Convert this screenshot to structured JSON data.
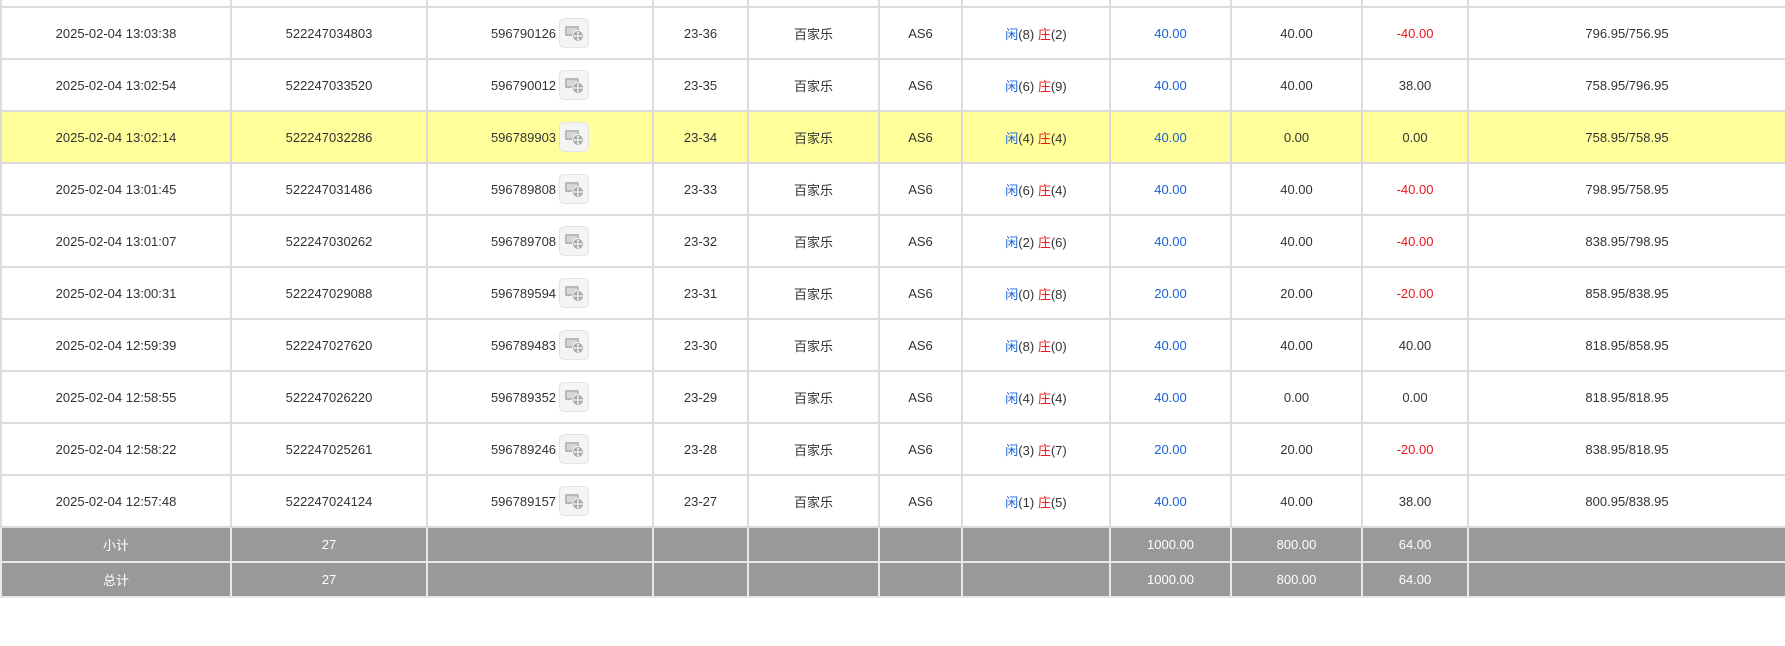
{
  "rows": [
    {
      "time": "2025-02-04 13:03:38",
      "order_id": "522247034803",
      "game_no": "596790126",
      "shoe": "23-36",
      "game_type": "百家乐",
      "table": "AS6",
      "player_label": "闲",
      "player_score": "(8)",
      "banker_label": "庄",
      "banker_score": "(2)",
      "bet": "40.00",
      "valid": "40.00",
      "winloss": "-40.00",
      "winloss_color": "red",
      "balance": "796.95/756.95",
      "highlight": false
    },
    {
      "time": "2025-02-04 13:02:54",
      "order_id": "522247033520",
      "game_no": "596790012",
      "shoe": "23-35",
      "game_type": "百家乐",
      "table": "AS6",
      "player_label": "闲",
      "player_score": "(6)",
      "banker_label": "庄",
      "banker_score": "(9)",
      "bet": "40.00",
      "valid": "40.00",
      "winloss": "38.00",
      "winloss_color": "normal",
      "balance": "758.95/796.95",
      "highlight": false
    },
    {
      "time": "2025-02-04 13:02:14",
      "order_id": "522247032286",
      "game_no": "596789903",
      "shoe": "23-34",
      "game_type": "百家乐",
      "table": "AS6",
      "player_label": "闲",
      "player_score": "(4)",
      "banker_label": "庄",
      "banker_score": "(4)",
      "bet": "40.00",
      "valid": "0.00",
      "winloss": "0.00",
      "winloss_color": "normal",
      "balance": "758.95/758.95",
      "highlight": true
    },
    {
      "time": "2025-02-04 13:01:45",
      "order_id": "522247031486",
      "game_no": "596789808",
      "shoe": "23-33",
      "game_type": "百家乐",
      "table": "AS6",
      "player_label": "闲",
      "player_score": "(6)",
      "banker_label": "庄",
      "banker_score": "(4)",
      "bet": "40.00",
      "valid": "40.00",
      "winloss": "-40.00",
      "winloss_color": "red",
      "balance": "798.95/758.95",
      "highlight": false
    },
    {
      "time": "2025-02-04 13:01:07",
      "order_id": "522247030262",
      "game_no": "596789708",
      "shoe": "23-32",
      "game_type": "百家乐",
      "table": "AS6",
      "player_label": "闲",
      "player_score": "(2)",
      "banker_label": "庄",
      "banker_score": "(6)",
      "bet": "40.00",
      "valid": "40.00",
      "winloss": "-40.00",
      "winloss_color": "red",
      "balance": "838.95/798.95",
      "highlight": false
    },
    {
      "time": "2025-02-04 13:00:31",
      "order_id": "522247029088",
      "game_no": "596789594",
      "shoe": "23-31",
      "game_type": "百家乐",
      "table": "AS6",
      "player_label": "闲",
      "player_score": "(0)",
      "banker_label": "庄",
      "banker_score": "(8)",
      "bet": "20.00",
      "valid": "20.00",
      "winloss": "-20.00",
      "winloss_color": "red",
      "balance": "858.95/838.95",
      "highlight": false
    },
    {
      "time": "2025-02-04 12:59:39",
      "order_id": "522247027620",
      "game_no": "596789483",
      "shoe": "23-30",
      "game_type": "百家乐",
      "table": "AS6",
      "player_label": "闲",
      "player_score": "(8)",
      "banker_label": "庄",
      "banker_score": "(0)",
      "bet": "40.00",
      "valid": "40.00",
      "winloss": "40.00",
      "winloss_color": "normal",
      "balance": "818.95/858.95",
      "highlight": false
    },
    {
      "time": "2025-02-04 12:58:55",
      "order_id": "522247026220",
      "game_no": "596789352",
      "shoe": "23-29",
      "game_type": "百家乐",
      "table": "AS6",
      "player_label": "闲",
      "player_score": "(4)",
      "banker_label": "庄",
      "banker_score": "(4)",
      "bet": "40.00",
      "valid": "0.00",
      "winloss": "0.00",
      "winloss_color": "normal",
      "balance": "818.95/818.95",
      "highlight": false
    },
    {
      "time": "2025-02-04 12:58:22",
      "order_id": "522247025261",
      "game_no": "596789246",
      "shoe": "23-28",
      "game_type": "百家乐",
      "table": "AS6",
      "player_label": "闲",
      "player_score": "(3)",
      "banker_label": "庄",
      "banker_score": "(7)",
      "bet": "20.00",
      "valid": "20.00",
      "winloss": "-20.00",
      "winloss_color": "red",
      "balance": "838.95/818.95",
      "highlight": false
    },
    {
      "time": "2025-02-04 12:57:48",
      "order_id": "522247024124",
      "game_no": "596789157",
      "shoe": "23-27",
      "game_type": "百家乐",
      "table": "AS6",
      "player_label": "闲",
      "player_score": "(1)",
      "banker_label": "庄",
      "banker_score": "(5)",
      "bet": "40.00",
      "valid": "40.00",
      "winloss": "38.00",
      "winloss_color": "normal",
      "balance": "800.95/838.95",
      "highlight": false
    }
  ],
  "subtotal": {
    "label": "小计",
    "count": "27",
    "bet": "1000.00",
    "valid": "800.00",
    "winloss": "64.00"
  },
  "total": {
    "label": "总计",
    "count": "27",
    "bet": "1000.00",
    "valid": "800.00",
    "winloss": "64.00"
  },
  "icons": {
    "game_detail": "video-reel-icon"
  },
  "colors": {
    "blue": "#1a63d8",
    "red": "#e8191d",
    "highlight": "#ffff9c",
    "summary_bg": "#999999"
  }
}
